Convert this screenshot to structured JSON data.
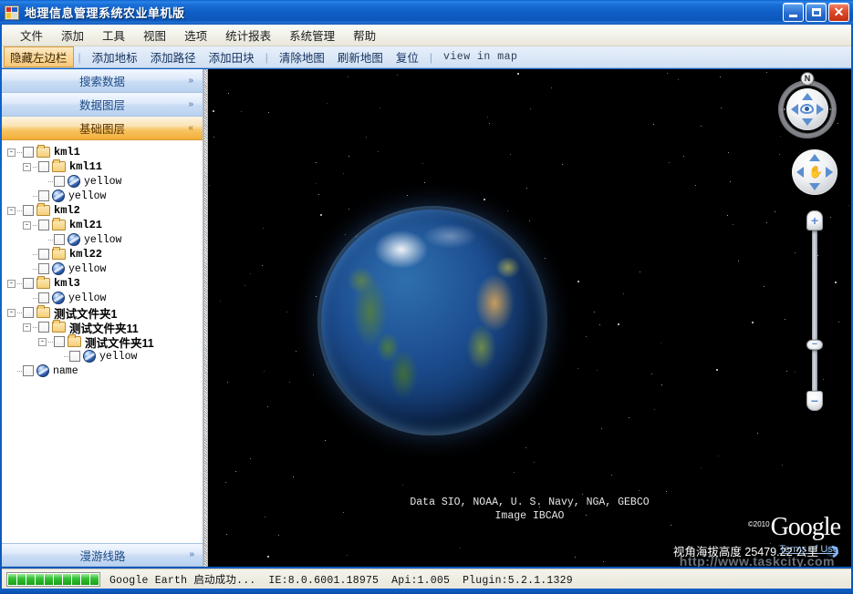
{
  "window": {
    "title": "地理信息管理系统农业单机版",
    "app_icon": "app-squares-icon",
    "buttons": {
      "minimize": "minimize-icon",
      "maximize": "maximize-icon",
      "close": "✕"
    }
  },
  "menubar": {
    "items": [
      {
        "label": "文件"
      },
      {
        "label": "添加"
      },
      {
        "label": "工具"
      },
      {
        "label": "视图"
      },
      {
        "label": "选项"
      },
      {
        "label": "统计报表"
      },
      {
        "label": "系统管理"
      },
      {
        "label": "帮助"
      }
    ]
  },
  "toolbar": {
    "items": [
      {
        "label": "隐藏左边栏",
        "active": true
      },
      {
        "label": "|",
        "sep": true
      },
      {
        "label": "添加地标"
      },
      {
        "label": "添加路径"
      },
      {
        "label": "添加田块"
      },
      {
        "label": "|",
        "sep": true
      },
      {
        "label": "清除地图"
      },
      {
        "label": "刷新地图"
      },
      {
        "label": "复位"
      },
      {
        "label": "|",
        "sep": true
      },
      {
        "label": "view in map",
        "mono": true
      }
    ]
  },
  "sidebar": {
    "accordions": [
      {
        "label": "搜索数据",
        "expanded": false,
        "chevron": "chevron-down-icon",
        "glyph": "»"
      },
      {
        "label": "数据图层",
        "expanded": false,
        "chevron": "chevron-down-icon",
        "glyph": "»"
      },
      {
        "label": "基础图层",
        "expanded": true,
        "chevron": "chevron-up-icon",
        "glyph": "«"
      }
    ],
    "bottom_accordion": {
      "label": "漫游线路",
      "expanded": false,
      "chevron": "chevron-down-icon",
      "glyph": "»"
    },
    "tree": [
      {
        "depth": 0,
        "label": "kml1",
        "icon": "folder",
        "expander": "-",
        "checked": false,
        "bold": true,
        "cjk": false
      },
      {
        "depth": 1,
        "label": "kml11",
        "icon": "folder",
        "expander": "-",
        "checked": false,
        "bold": true,
        "cjk": false
      },
      {
        "depth": 2,
        "label": "yellow",
        "icon": "globe",
        "expander": "",
        "checked": false,
        "bold": false,
        "cjk": false
      },
      {
        "depth": 1,
        "label": "yellow",
        "icon": "globe",
        "expander": "",
        "checked": false,
        "bold": false,
        "cjk": false
      },
      {
        "depth": 0,
        "label": "kml2",
        "icon": "folder",
        "expander": "-",
        "checked": false,
        "bold": true,
        "cjk": false
      },
      {
        "depth": 1,
        "label": "kml21",
        "icon": "folder",
        "expander": "-",
        "checked": false,
        "bold": true,
        "cjk": false
      },
      {
        "depth": 2,
        "label": "yellow",
        "icon": "globe",
        "expander": "",
        "checked": false,
        "bold": false,
        "cjk": false
      },
      {
        "depth": 1,
        "label": "kml22",
        "icon": "folder",
        "expander": "",
        "checked": false,
        "bold": true,
        "cjk": false
      },
      {
        "depth": 1,
        "label": "yellow",
        "icon": "globe",
        "expander": "",
        "checked": false,
        "bold": false,
        "cjk": false
      },
      {
        "depth": 0,
        "label": "kml3",
        "icon": "folder",
        "expander": "-",
        "checked": false,
        "bold": true,
        "cjk": false
      },
      {
        "depth": 1,
        "label": "yellow",
        "icon": "globe",
        "expander": "",
        "checked": false,
        "bold": false,
        "cjk": false
      },
      {
        "depth": 0,
        "label": "测试文件夹1",
        "icon": "folder",
        "expander": "-",
        "checked": false,
        "bold": true,
        "cjk": true
      },
      {
        "depth": 1,
        "label": "测试文件夹11",
        "icon": "folder",
        "expander": "-",
        "checked": false,
        "bold": true,
        "cjk": true
      },
      {
        "depth": 2,
        "label": "测试文件夹11",
        "icon": "folder",
        "expander": "-",
        "checked": false,
        "bold": true,
        "cjk": true
      },
      {
        "depth": 3,
        "label": "yellow",
        "icon": "globe",
        "expander": "",
        "checked": false,
        "bold": false,
        "cjk": false
      },
      {
        "depth": 0,
        "label": "name",
        "icon": "globe",
        "expander": "",
        "checked": false,
        "bold": false,
        "cjk": false
      }
    ]
  },
  "map": {
    "attribution_line1": "Data SIO, NOAA, U. S. Navy, NGA, GEBCO",
    "attribution_line2": "Image IBCAO",
    "google_logo": "Google",
    "google_copyright": "©2010",
    "terms_link": "Terms of Use",
    "elevation": "视角海拔高度 25479.22 公里",
    "watermark": "http://www.taskcity.com",
    "loading_spinner": "loading-spinner-icon"
  },
  "navigation": {
    "compass": {
      "north_label": "N",
      "center_icon": "eye-icon",
      "up": "arrow-up-icon",
      "down": "arrow-down-icon",
      "left": "arrow-left-icon",
      "right": "arrow-right-icon"
    },
    "pan": {
      "center_icon": "hand-icon",
      "up": "arrow-up-icon",
      "down": "arrow-down-icon",
      "left": "arrow-left-icon",
      "right": "arrow-right-icon"
    },
    "zoom": {
      "plus_label": "+",
      "minus_label": "−",
      "handle_label": "−"
    }
  },
  "statusbar": {
    "progress_blocks": 10,
    "messages": [
      "Google Earth 启动成功...",
      "IE:8.0.6001.18975",
      "Api:1.005",
      "Plugin:5.2.1.1329"
    ]
  },
  "colors": {
    "titlebar_blue": "#0f62cc",
    "accent_orange": "#f3ae38",
    "tree_text": "#000000",
    "link_blue": "#9fc4f2",
    "progress_green": "#35c135"
  }
}
